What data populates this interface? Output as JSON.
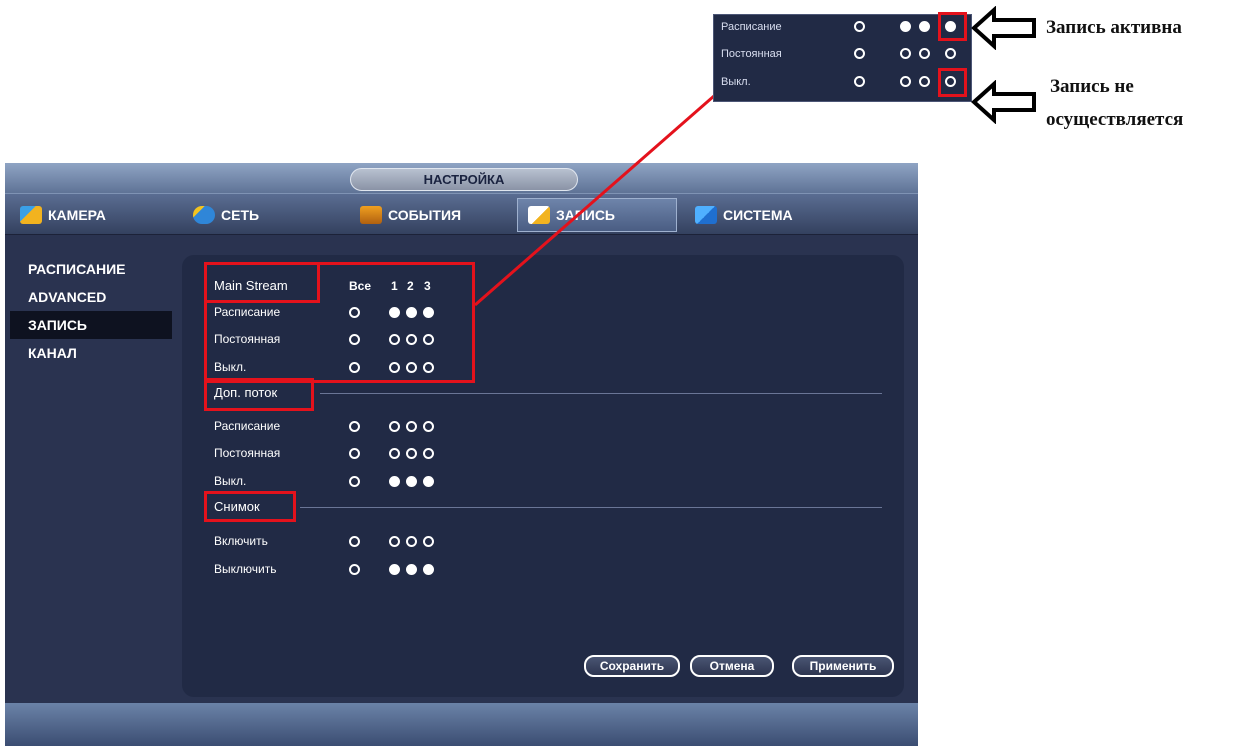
{
  "window": {
    "title": "НАСТРОЙКА"
  },
  "tabs": [
    {
      "label": "КАМЕРА",
      "icon": "camera-icon",
      "active": false
    },
    {
      "label": "СЕТЬ",
      "icon": "network-icon",
      "active": false
    },
    {
      "label": "СОБЫТИЯ",
      "icon": "events-icon",
      "active": false
    },
    {
      "label": "ЗАПИСЬ",
      "icon": "record-icon",
      "active": true
    },
    {
      "label": "СИСТЕМА",
      "icon": "system-icon",
      "active": false
    }
  ],
  "sidebar": {
    "items": [
      {
        "label": "РАСПИСАНИЕ",
        "active": false
      },
      {
        "label": "ADVANCED",
        "active": false
      },
      {
        "label": "ЗАПИСЬ",
        "active": true
      },
      {
        "label": "КАНАЛ",
        "active": false
      }
    ]
  },
  "panel": {
    "columns": {
      "all": "Все",
      "channels": [
        "1",
        "2",
        "3"
      ]
    },
    "main_stream": {
      "title": "Main Stream",
      "rows": [
        {
          "label": "Расписание",
          "all": false,
          "channels": [
            true,
            true,
            true
          ]
        },
        {
          "label": "Постоянная",
          "all": false,
          "channels": [
            false,
            false,
            false
          ]
        },
        {
          "label": "Выкл.",
          "all": false,
          "channels": [
            false,
            false,
            false
          ]
        }
      ]
    },
    "sub_stream": {
      "title": "Доп. поток",
      "rows": [
        {
          "label": "Расписание",
          "all": false,
          "channels": [
            false,
            false,
            false
          ]
        },
        {
          "label": "Постоянная",
          "all": false,
          "channels": [
            false,
            false,
            false
          ]
        },
        {
          "label": "Выкл.",
          "all": false,
          "channels": [
            true,
            true,
            true
          ]
        }
      ]
    },
    "snapshot": {
      "title": "Снимок",
      "rows": [
        {
          "label": "Включить",
          "all": false,
          "channels": [
            false,
            false,
            false
          ]
        },
        {
          "label": "Выключить",
          "all": false,
          "channels": [
            true,
            true,
            true
          ]
        }
      ]
    },
    "buttons": {
      "save": "Сохранить",
      "cancel": "Отмена",
      "apply": "Применить"
    }
  },
  "inset": {
    "rows": [
      {
        "label": "Расписание",
        "all": false,
        "channels": [
          true,
          true,
          true
        ]
      },
      {
        "label": "Постоянная",
        "all": false,
        "channels": [
          false,
          false,
          false
        ]
      },
      {
        "label": "Выкл.",
        "all": false,
        "channels": [
          false,
          false,
          false
        ]
      }
    ]
  },
  "callouts": {
    "active": "Запись активна",
    "inactive_line1": "Запись не",
    "inactive_line2": "осуществляется"
  },
  "colors": {
    "highlight": "#e4121c",
    "panel_bg": "#212a45",
    "window_bg": "#2a3350"
  }
}
